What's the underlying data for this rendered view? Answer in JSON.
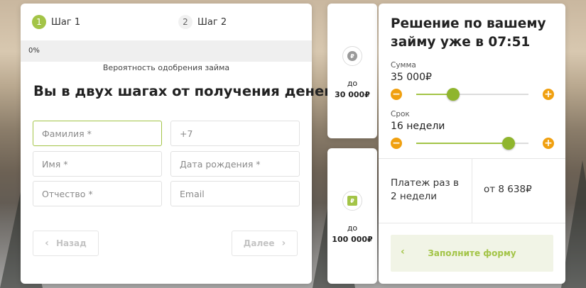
{
  "colors": {
    "accent": "#a3c447",
    "orange": "#f0a010",
    "muted": "#c4c4c4"
  },
  "steps": [
    {
      "number": "1",
      "label": "Шаг 1"
    },
    {
      "number": "2",
      "label": "Шаг 2"
    }
  ],
  "progress": {
    "percent_text": "0%",
    "value": 0
  },
  "approval_label": "Вероятность одобрения займа",
  "form": {
    "title": "Вы в двух шагах от получения денег",
    "fields": {
      "last_name": "Фамилия *",
      "phone": "+7",
      "first_name": "Имя *",
      "birth_date": "Дата рождения *",
      "patronymic": "Отчество *",
      "email": "Email"
    },
    "back_label": "Назад",
    "next_label": "Далее"
  },
  "offers": [
    {
      "icon": "ruble-coin-icon",
      "up_to": "до",
      "amount": "30 000₽"
    },
    {
      "icon": "ruble-wallet-icon",
      "up_to": "до",
      "amount": "100 000₽"
    }
  ],
  "decision": {
    "title": "Решение по вашему займу уже в 07:51",
    "amount_label": "Сумма",
    "amount_value": "35 000₽",
    "amount_slider": 0.33,
    "term_label": "Срок",
    "term_value": "16 недели",
    "term_slider": 0.82,
    "payment_label": "Платеж раз в 2 недели",
    "payment_value": "от 8 638₽",
    "fill_form_label": "Заполните форму"
  }
}
